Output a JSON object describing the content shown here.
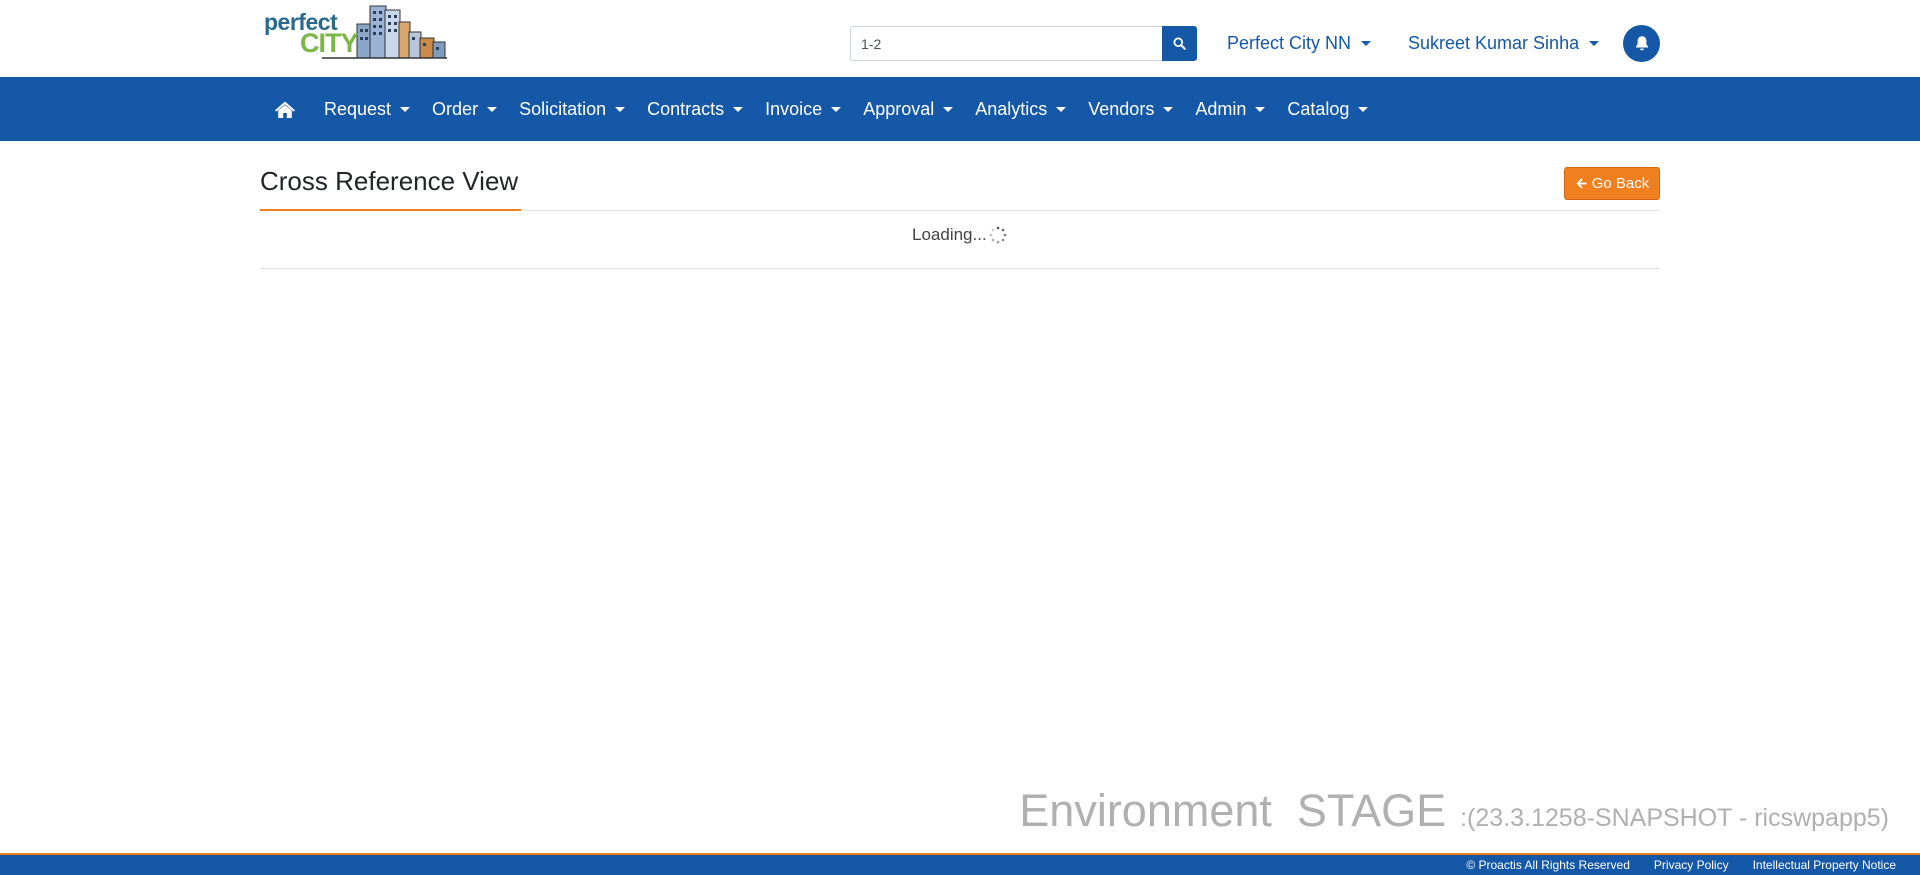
{
  "header": {
    "logo_line1": "perfect",
    "logo_line2": "CITY",
    "search": {
      "value": "1-2",
      "placeholder": ""
    },
    "org_selector": "Perfect City NN",
    "user_menu": "Sukreet Kumar Sinha"
  },
  "nav": {
    "items": [
      {
        "label": "Request"
      },
      {
        "label": "Order"
      },
      {
        "label": "Solicitation"
      },
      {
        "label": "Contracts"
      },
      {
        "label": "Invoice"
      },
      {
        "label": "Approval"
      },
      {
        "label": "Analytics"
      },
      {
        "label": "Vendors"
      },
      {
        "label": "Admin"
      },
      {
        "label": "Catalog"
      }
    ]
  },
  "main": {
    "title": "Cross Reference View",
    "go_back_label": "Go Back",
    "loading_text": "Loading..."
  },
  "environment": {
    "label": "Environment  STAGE",
    "version": ":(23.3.1258-SNAPSHOT - ricswpapp5)"
  },
  "footer": {
    "copyright": "© Proactis All Rights Reserved",
    "privacy": "Privacy Policy",
    "ip_notice": "Intellectual Property Notice"
  },
  "colors": {
    "primary": "#1558a7",
    "accent": "#f07f20",
    "watermark": "#b0b0b0"
  },
  "icons": [
    "search-icon",
    "home-icon",
    "bell-icon",
    "arrow-left-icon",
    "spinner-icon",
    "chevron-down-icon"
  ]
}
